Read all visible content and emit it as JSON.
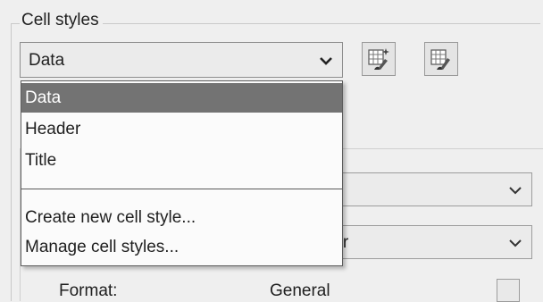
{
  "cell_styles": {
    "group_title": "Cell styles",
    "selected": "Data",
    "options": [
      "Data",
      "Header",
      "Title"
    ],
    "actions": [
      "Create new cell style...",
      "Manage cell styles..."
    ],
    "buttons": [
      {
        "name": "create-new-cell-style-button",
        "icon": "table-sparkle-icon"
      },
      {
        "name": "manage-cell-styles-button",
        "icon": "table-brush-icon"
      }
    ]
  },
  "properties": {
    "row1_value": "e",
    "row2_value": "ter",
    "format_label": "Format:",
    "format_value": "General"
  },
  "colors": {
    "selection": "#737373",
    "background": "#efefef"
  }
}
